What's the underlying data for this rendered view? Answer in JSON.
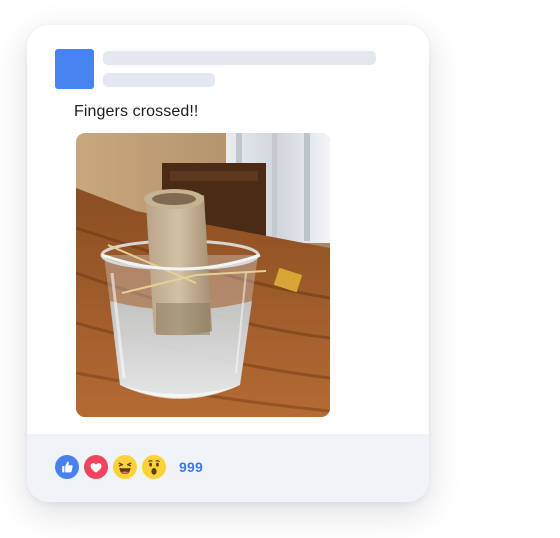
{
  "colors": {
    "accent": "#3d7ae8",
    "avatar": "#4682f0",
    "skeleton": "#e3e7ef",
    "footer_bg": "#f0f3f7",
    "like": "#4a7ff0",
    "love": "#f0445c",
    "emoji_yellow": "#fdd13a"
  },
  "post": {
    "avatar_icon": "avatar-placeholder",
    "text": "Fingers crossed!!",
    "photo_description_icon": "photo"
  },
  "footer": {
    "reactions": [
      {
        "name": "like-reaction",
        "icon": "thumbs-up-icon"
      },
      {
        "name": "love-reaction",
        "icon": "heart-icon"
      },
      {
        "name": "haha-reaction",
        "icon": "laughing-face-icon"
      },
      {
        "name": "wow-reaction",
        "icon": "surprised-face-icon"
      }
    ],
    "count": "999"
  }
}
